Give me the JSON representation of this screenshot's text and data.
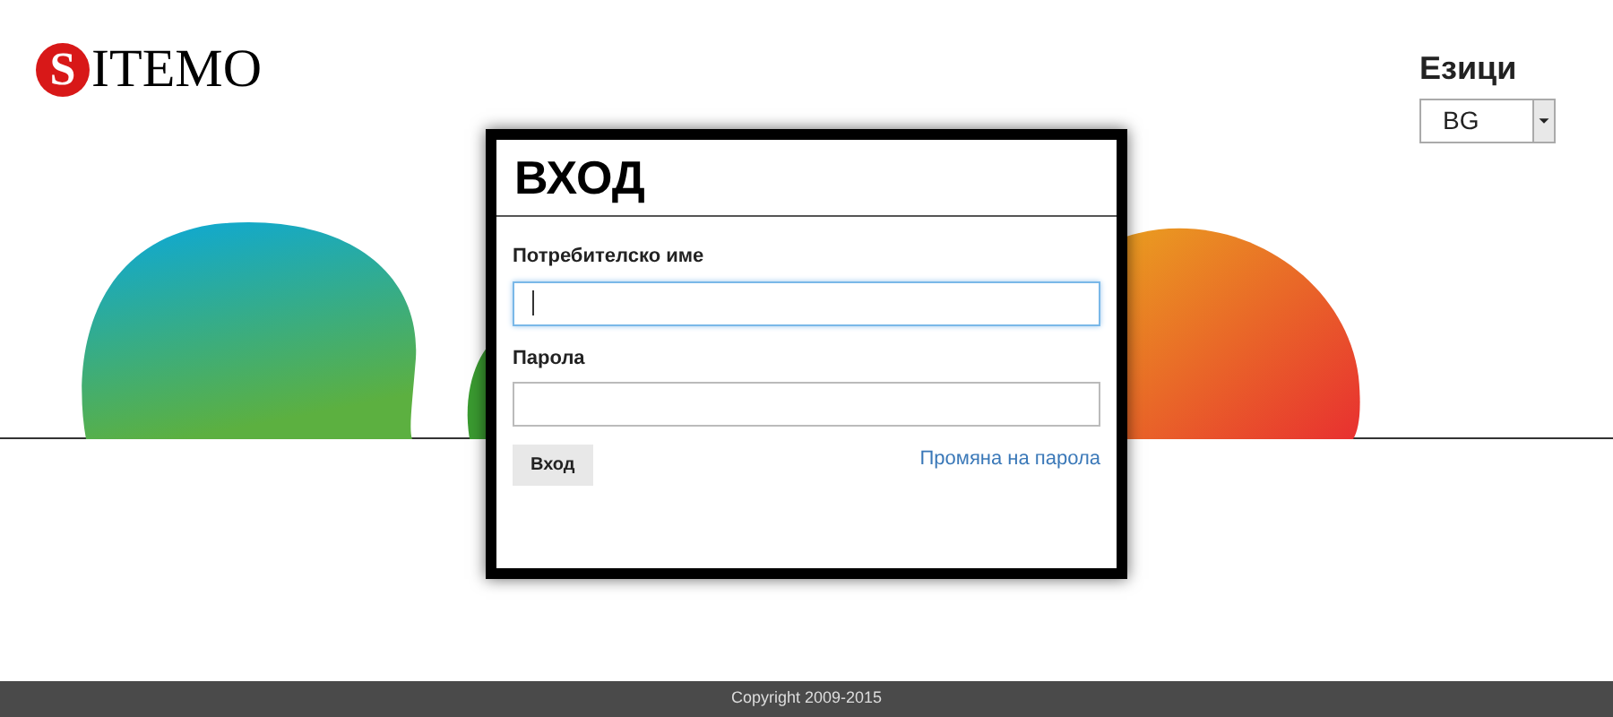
{
  "logo": {
    "initial": "S",
    "rest": "ITEMO"
  },
  "languages": {
    "title": "Езици",
    "select": {
      "value": "BG"
    }
  },
  "login": {
    "title": "ВХОД",
    "fields": [
      {
        "label": "Потребителско име",
        "focused": true
      },
      {
        "label": "Парола",
        "focused": false
      }
    ],
    "submit": "Вход",
    "link": "Промяна на парола"
  },
  "footer": {
    "copyright": "Copyright 2009-2015"
  }
}
